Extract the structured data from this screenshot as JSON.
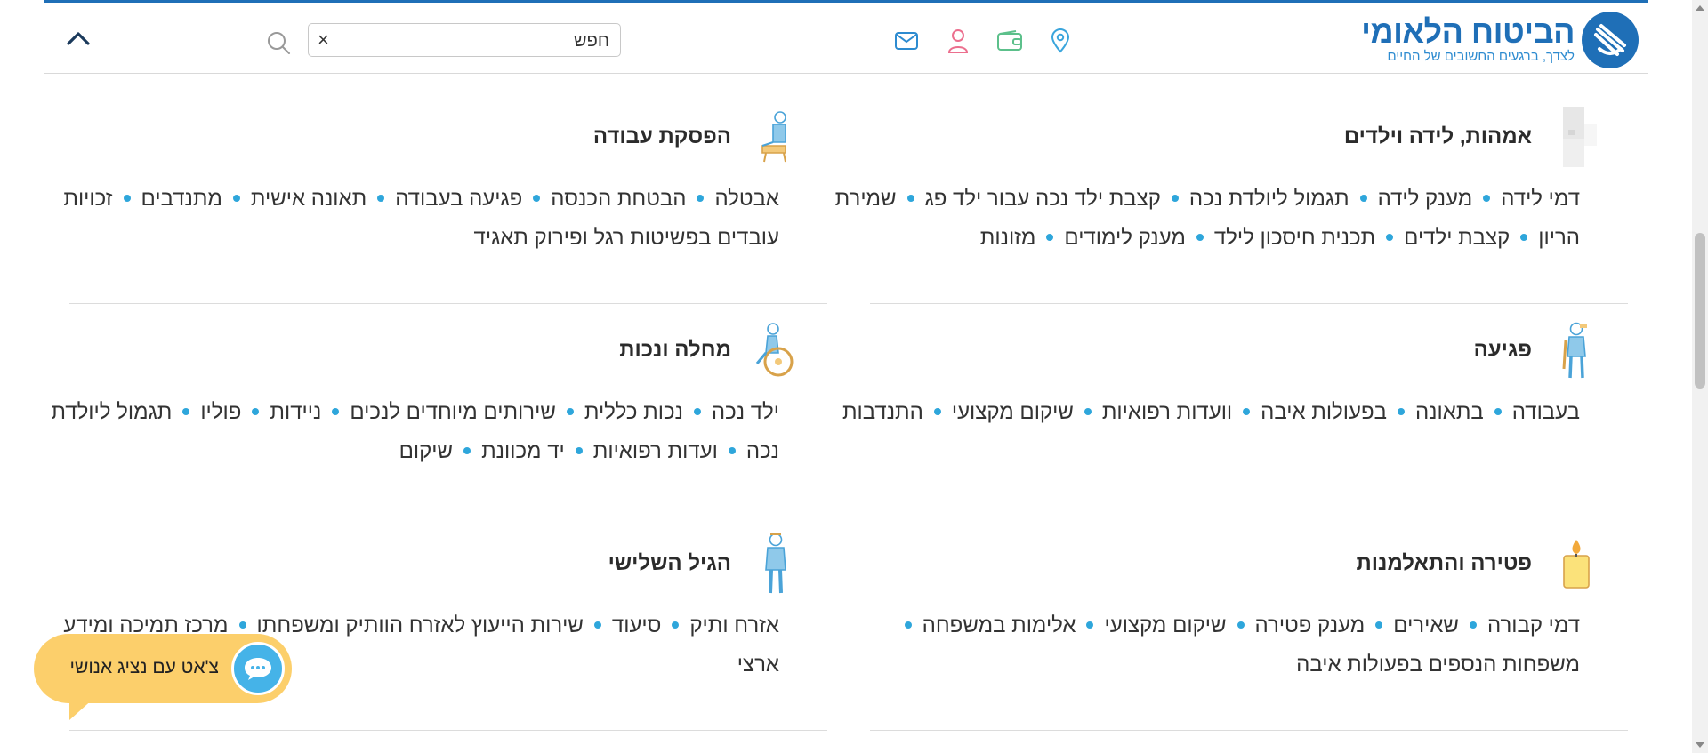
{
  "header": {
    "logo_title": "הביטוח הלאומי",
    "logo_subtitle": "לצדך, ברגעים החשובים של החיים",
    "search_placeholder": "חפש",
    "clear_label": "×",
    "icons": [
      "location-icon",
      "wallet-icon",
      "user-icon",
      "mail-icon",
      "search-icon",
      "chevron-up-icon"
    ]
  },
  "categories": [
    {
      "title": "אמהות, לידה וילדים",
      "icon": "mother-child-icon",
      "links": [
        "דמי לידה",
        "מענק לידה",
        "תגמול ליולדת נכה",
        "קצבת ילד נכה עבור ילד פג",
        "שמירת הריון",
        "קצבת ילדים",
        "תכנית חיסכון לילד",
        "מענק לימודים",
        "מזונות"
      ]
    },
    {
      "title": "הפסקת עבודה",
      "icon": "seated-worker-icon",
      "links": [
        "אבטלה",
        "הבטחת הכנסה",
        "פגיעה בעבודה",
        "תאונה אישית",
        "מתנדבים",
        "זכויות עובדים בפשיטות רגל ופירוק תאגיד"
      ]
    },
    {
      "title": "פגיעה",
      "icon": "injured-person-icon",
      "links": [
        "בעבודה",
        "בתאונה",
        "בפעולות איבה",
        "וועדות רפואיות",
        "שיקום מקצועי",
        "התנדבות"
      ]
    },
    {
      "title": "מחלה ונכות",
      "icon": "wheelchair-icon",
      "links": [
        "ילד נכה",
        "נכות כללית",
        "שירותים מיוחדים לנכים",
        "ניידות",
        "פוליו",
        "תגמול ליולדת נכה",
        "ועדות רפואיות",
        "יד מכוונת",
        "שיקום"
      ]
    },
    {
      "title": "פטירה והתאלמנות",
      "icon": "candle-icon",
      "links": [
        "דמי קבורה",
        "שאירים",
        "מענק פטירה",
        "שיקום מקצועי",
        "אלימות במשפחה",
        "משפחות הנספים בפעולות איבה"
      ]
    },
    {
      "title": "הגיל השלישי",
      "icon": "elderly-person-icon",
      "links": [
        "אזרח ותיק",
        "סיעוד",
        "שירות הייעוץ לאזרח הוותיק ומשפחתו",
        "מרכז תמיכה ומידע ארצי"
      ]
    }
  ],
  "chat": {
    "label": "צ'אט עם נציג אנושי"
  },
  "colors": {
    "brand_blue": "#1f6fb7",
    "bullet_blue": "#2ea6db",
    "chat_yellow": "#fccf6b",
    "chat_icon_blue": "#45b3e8"
  }
}
